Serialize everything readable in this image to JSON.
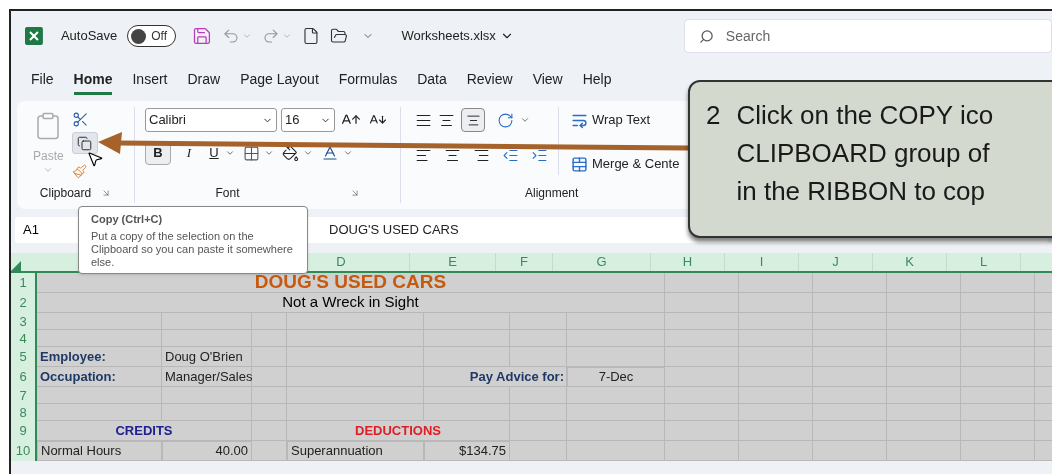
{
  "title_bar": {
    "autosave_label": "AutoSave",
    "autosave_toggle": {
      "label": "Off",
      "on": false
    },
    "file_name": "Worksheets.xlsx",
    "search": {
      "placeholder": "Search"
    }
  },
  "tabs": [
    {
      "label": "File",
      "selected": false
    },
    {
      "label": "Home",
      "selected": true
    },
    {
      "label": "Insert",
      "selected": false
    },
    {
      "label": "Draw",
      "selected": false
    },
    {
      "label": "Page Layout",
      "selected": false
    },
    {
      "label": "Formulas",
      "selected": false
    },
    {
      "label": "Data",
      "selected": false
    },
    {
      "label": "Review",
      "selected": false
    },
    {
      "label": "View",
      "selected": false
    },
    {
      "label": "Help",
      "selected": false
    }
  ],
  "ribbon": {
    "clipboard": {
      "paste_label": "Paste",
      "paste_disabled": true,
      "group_label": "Clipboard"
    },
    "font": {
      "font_name": "Calibri",
      "font_size": "16",
      "bold_label": "B",
      "italic_label": "I",
      "underline_label": "U",
      "group_label": "Font"
    },
    "alignment": {
      "wrap_text": "Wrap Text",
      "merge_center": "Merge & Cente",
      "group_label": "Alignment"
    }
  },
  "formula_bar": {
    "name_box": "A1",
    "content": "DOUG'S USED CARS"
  },
  "tooltip": {
    "title": "Copy (Ctrl+C)",
    "body": "Put a copy of the selection on the Clipboard so you can paste it somewhere else."
  },
  "sheet": {
    "column_headers": [
      "D",
      "E",
      "F",
      "G",
      "H",
      "I",
      "J",
      "K",
      "L"
    ],
    "rows": [
      {
        "number": "1",
        "cells": [
          {
            "kind": "title",
            "text": "DOUG'S USED CARS"
          }
        ]
      },
      {
        "number": "2",
        "cells": [
          {
            "kind": "subtitle",
            "text": "Not a Wreck in Sight"
          }
        ]
      },
      {
        "number": "3",
        "cells": []
      },
      {
        "number": "4",
        "cells": []
      },
      {
        "number": "5",
        "cells": [
          {
            "kind": "label",
            "text": "Employee:"
          },
          {
            "kind": "value",
            "text": "Doug O'Brien"
          }
        ]
      },
      {
        "number": "6",
        "cells": [
          {
            "kind": "label",
            "text": "Occupation:"
          },
          {
            "kind": "value",
            "text": "Manager/Sales"
          },
          "",
          "",
          {
            "kind": "pay_label",
            "text": "Pay Advice for:"
          },
          {
            "kind": "date",
            "text": "7-Dec"
          }
        ]
      },
      {
        "number": "7",
        "cells": []
      },
      {
        "number": "8",
        "cells": []
      },
      {
        "number": "9",
        "cells": [
          {
            "kind": "credits_heading",
            "text": "CREDITS"
          },
          "",
          {
            "kind": "deductions_heading",
            "text": "DEDUCTIONS"
          }
        ]
      },
      {
        "number": "10",
        "cells": [
          {
            "kind": "item_left",
            "text": "Normal Hours"
          },
          {
            "kind": "amount_left",
            "text": "40.00"
          },
          "",
          {
            "kind": "item_right",
            "text": "Superannuation"
          },
          {
            "kind": "amount_right",
            "text": "$134.75"
          }
        ]
      }
    ]
  },
  "callout": {
    "step": "2",
    "lines": [
      "Click on the COPY ico",
      "CLIPBOARD group of",
      "in the RIBBON to cop"
    ]
  }
}
